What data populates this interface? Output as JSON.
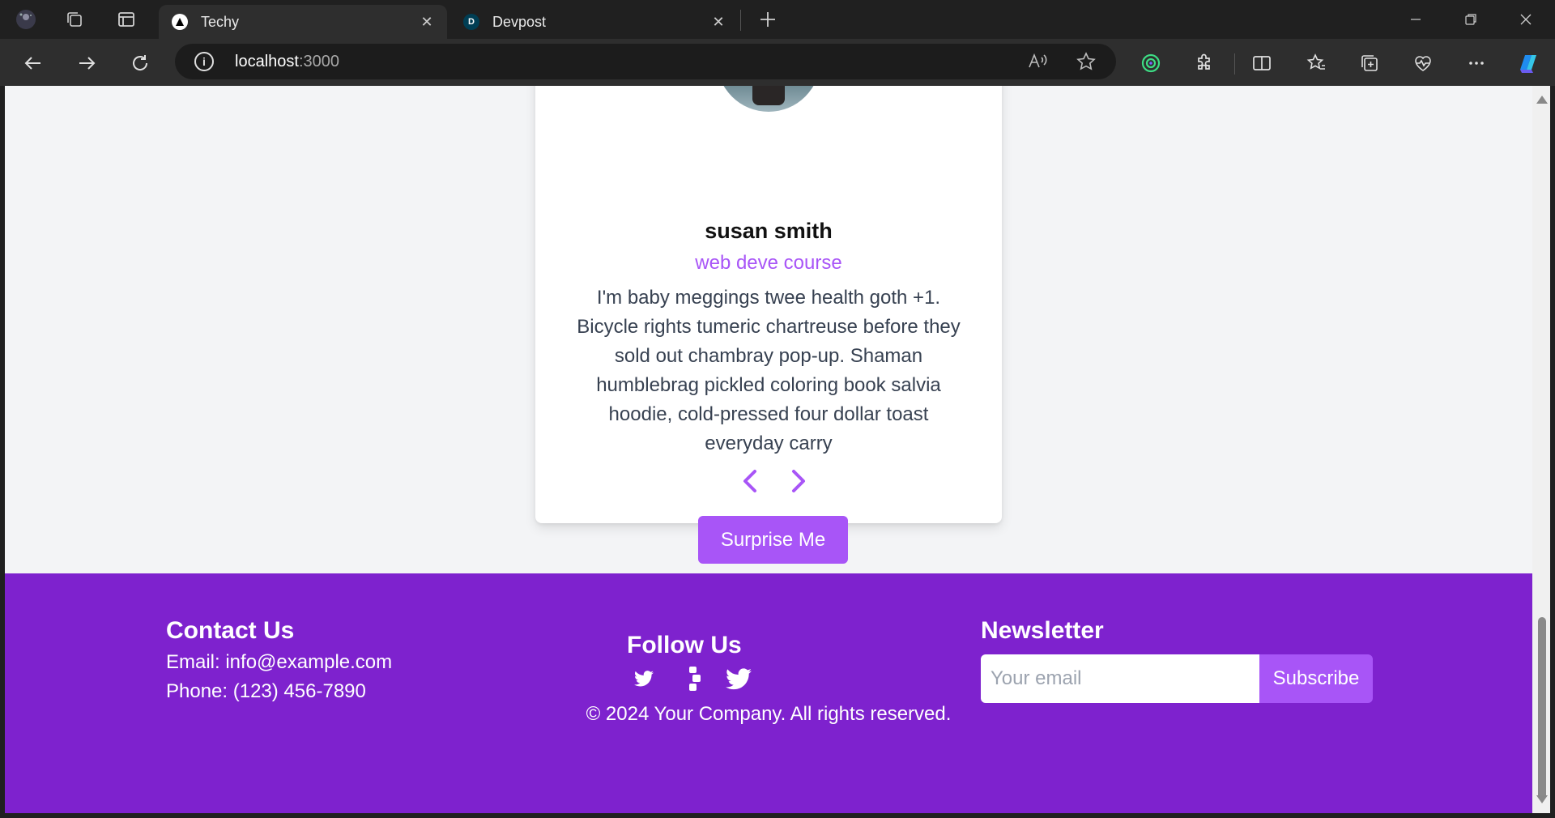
{
  "browser": {
    "tabs": [
      {
        "title": "Techy",
        "active": true
      },
      {
        "title": "Devpost",
        "active": false
      }
    ],
    "address": {
      "host": "localhost",
      "port": ":3000"
    }
  },
  "review": {
    "name": "susan smith",
    "job": "web deve course",
    "text": "I'm baby meggings twee health goth +1. Bicycle rights tumeric chartreuse before they sold out chambray pop-up. Shaman humblebrag pickled coloring book salvia hoodie, cold-pressed four dollar toast everyday carry",
    "surprise_label": "Surprise Me"
  },
  "footer": {
    "contact": {
      "heading": "Contact Us",
      "email": "Email: info@example.com",
      "phone": "Phone: (123) 456-7890"
    },
    "follow": {
      "heading": "Follow Us"
    },
    "newsletter": {
      "heading": "Newsletter",
      "placeholder": "Your email",
      "button": "Subscribe"
    },
    "copyright": "© 2024 Your Company. All rights reserved."
  },
  "colors": {
    "accent": "#a855f7",
    "footer_bg": "#7e22ce",
    "page_bg": "#f3f4f6"
  }
}
